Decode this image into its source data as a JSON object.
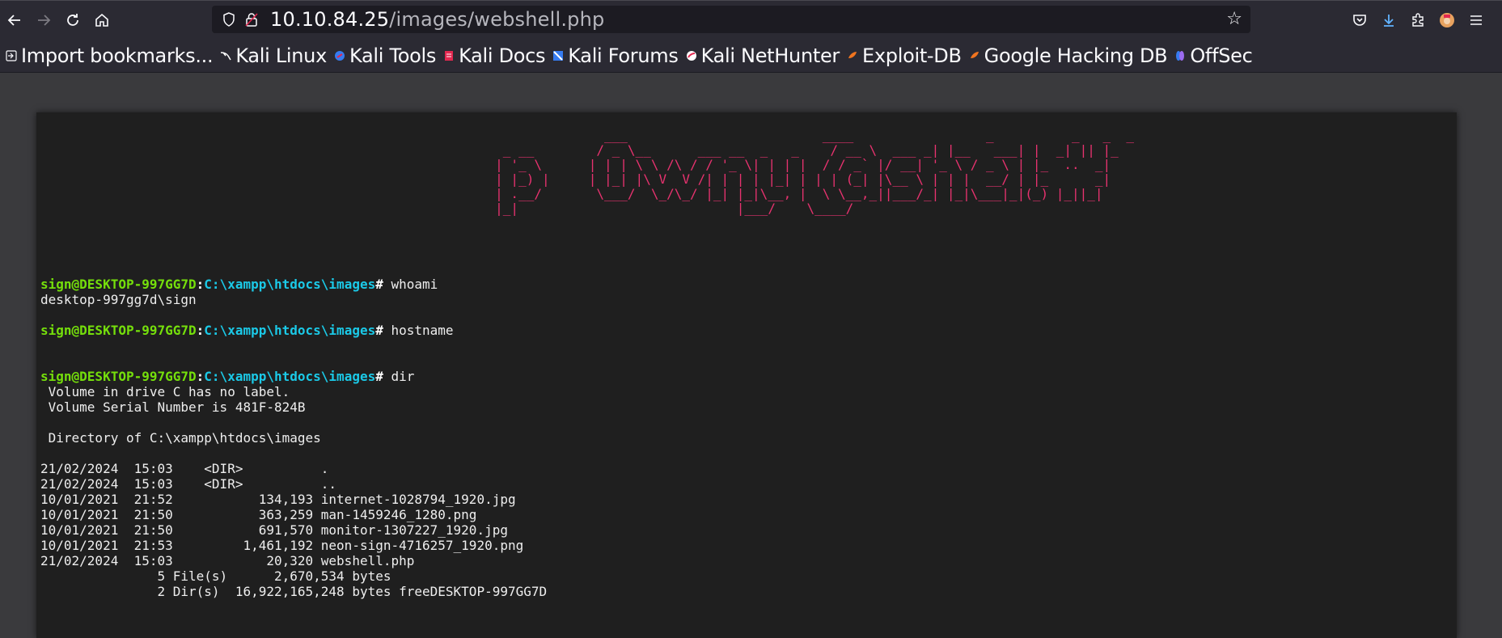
{
  "browser": {
    "url_host": "10.10.84.25",
    "url_path": "/images/webshell.php"
  },
  "bookmarks": [
    {
      "label": "Import bookmarks...",
      "icon": "import-icon"
    },
    {
      "label": "Kali Linux",
      "icon": "kali-dragon-icon"
    },
    {
      "label": "Kali Tools",
      "icon": "kali-tools-icon"
    },
    {
      "label": "Kali Docs",
      "icon": "kali-docs-icon"
    },
    {
      "label": "Kali Forums",
      "icon": "kali-forums-icon"
    },
    {
      "label": "Kali NetHunter",
      "icon": "nethunter-icon"
    },
    {
      "label": "Exploit-DB",
      "icon": "exploit-db-icon"
    },
    {
      "label": "Google Hacking DB",
      "icon": "ghdb-icon"
    },
    {
      "label": "OffSec",
      "icon": "offsec-icon"
    }
  ],
  "shell": {
    "banner": "                   ___                         ____                 _          _   _  _\n      _ __        / _ \\__      ___ __  _   _    / __ \\  ___ _| |__   ___| |  _| || |_\n     | '_ \\      | | | \\ \\ /\\ / / '_ \\| | | |  / / _` |/ __| '_ \\ / _ \\ | |_  ..  _|\n     | |_) |     | |_| |\\ V  V /| | | | |_| | | | (_| |\\__ \\ | | |  __/ | |_      _|\n     | .__/       \\___/  \\_/\\_/ |_| |_|\\__, |  \\ \\__,_||___/_| |_|\\___|_|(_) |_||_|\n     |_|                            |___/    \\____/",
    "prompt_user": "sign@DESKTOP-997GG7D",
    "prompt_path": "C:\\xampp\\htdocs\\images",
    "commands": [
      {
        "cmd": "whoami",
        "output": [
          "desktop-997gg7d\\sign"
        ]
      },
      {
        "cmd": "hostname",
        "output": [
          ""
        ]
      },
      {
        "cmd": "dir",
        "output": [
          " Volume in drive C has no label.",
          " Volume Serial Number is 481F-824B",
          "",
          " Directory of C:\\xampp\\htdocs\\images",
          "",
          "21/02/2024  15:03    <DIR>          .",
          "21/02/2024  15:03    <DIR>          ..",
          "10/01/2021  21:52           134,193 internet-1028794_1920.jpg",
          "10/01/2021  21:50           363,259 man-1459246_1280.png",
          "10/01/2021  21:50           691,570 monitor-1307227_1920.jpg",
          "10/01/2021  21:53         1,461,192 neon-sign-4716257_1920.png",
          "21/02/2024  15:03            20,320 webshell.php",
          "               5 File(s)      2,670,534 bytes",
          "               2 Dir(s)  16,922,165,248 bytes freeDESKTOP-997GG7D"
        ]
      }
    ]
  }
}
